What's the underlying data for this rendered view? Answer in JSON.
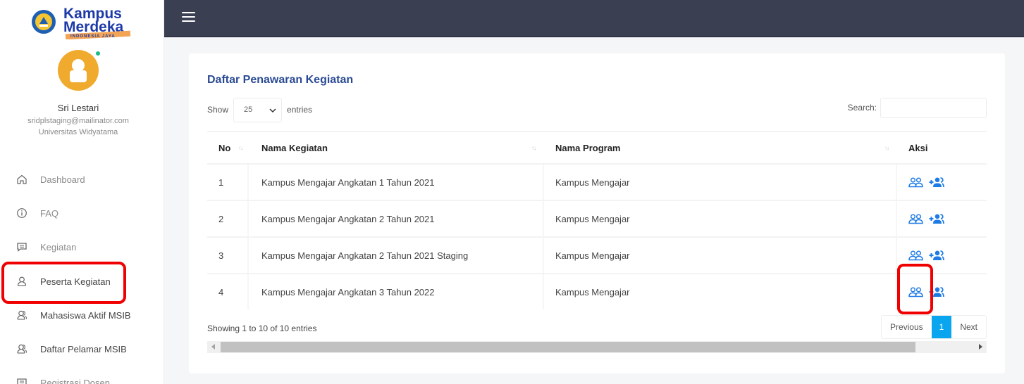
{
  "brand": {
    "name_line1": "Kampus",
    "name_line2": "Merdeka",
    "tagline": "INDONESIA JAYA"
  },
  "user": {
    "name": "Sri Lestari",
    "email": "sridplstaging@mailinator.com",
    "university": "Universitas Widyatama",
    "status": "online"
  },
  "sidebar": {
    "items": [
      {
        "label": "Dashboard",
        "icon": "home-icon"
      },
      {
        "label": "FAQ",
        "icon": "info-icon"
      },
      {
        "label": "Kegiatan",
        "icon": "message-icon"
      },
      {
        "label": "Peserta Kegiatan",
        "icon": "user-icon",
        "active": true
      },
      {
        "label": "Mahasiswa Aktif MSIB",
        "icon": "users-icon"
      },
      {
        "label": "Daftar Pelamar MSIB",
        "icon": "users-icon"
      },
      {
        "label": "Registrasi Dosen",
        "icon": "message-icon"
      }
    ]
  },
  "main": {
    "title": "Daftar Penawaran Kegiatan",
    "length": {
      "show_label": "Show",
      "value": "25",
      "entries_label": "entries"
    },
    "search": {
      "label": "Search:",
      "value": "",
      "placeholder": ""
    },
    "table": {
      "headers": [
        "No",
        "Nama Kegiatan",
        "Nama Program",
        "Aksi"
      ],
      "rows": [
        {
          "no": "1",
          "kegiatan": "Kampus Mengajar Angkatan 1 Tahun 2021",
          "program": "Kampus Mengajar"
        },
        {
          "no": "2",
          "kegiatan": "Kampus Mengajar Angkatan 2 Tahun 2021",
          "program": "Kampus Mengajar"
        },
        {
          "no": "3",
          "kegiatan": "Kampus Mengajar Angkatan 2 Tahun 2021 Staging",
          "program": "Kampus Mengajar"
        },
        {
          "no": "4",
          "kegiatan": "Kampus Mengajar Angkatan 3 Tahun 2022",
          "program": "Kampus Mengajar"
        }
      ],
      "actions": [
        "view-participants-icon",
        "add-participants-icon"
      ]
    },
    "info": "Showing 1 to 10 of 10 entries",
    "pagination": {
      "previous": "Previous",
      "current": "1",
      "next": "Next"
    }
  },
  "colors": {
    "topbar": "#3a3f51",
    "title": "#2a4a93",
    "accent": "#0aa5ef",
    "action_icon": "#1e7be6",
    "avatar": "#f0ab2e",
    "highlight": "#f00000"
  }
}
